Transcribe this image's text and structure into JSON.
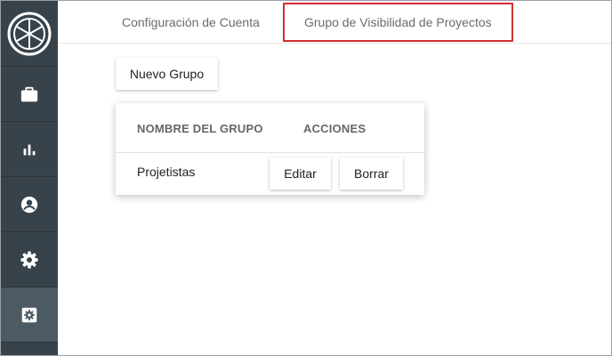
{
  "sidebar": {
    "items": [
      {
        "icon": "briefcase-icon"
      },
      {
        "icon": "bar-chart-icon"
      },
      {
        "icon": "account-circle-icon"
      },
      {
        "icon": "gear-icon"
      },
      {
        "icon": "settings-box-icon"
      }
    ],
    "active_index": 4,
    "background": "#37424a",
    "active_background": "#4b5a63"
  },
  "tabs": [
    {
      "label": "Configuración de Cuenta"
    },
    {
      "label": "Grupo de Visibilidad de Proyectos",
      "highlighted": true
    }
  ],
  "highlight_color": "#d32f2f",
  "toolbar": {
    "new_group_label": "Nuevo Grupo"
  },
  "table": {
    "headers": [
      "NOMBRE DEL GRUPO",
      "ACCIONES"
    ],
    "rows": [
      {
        "name": "Projetistas",
        "edit_label": "Editar",
        "delete_label": "Borrar"
      }
    ]
  }
}
